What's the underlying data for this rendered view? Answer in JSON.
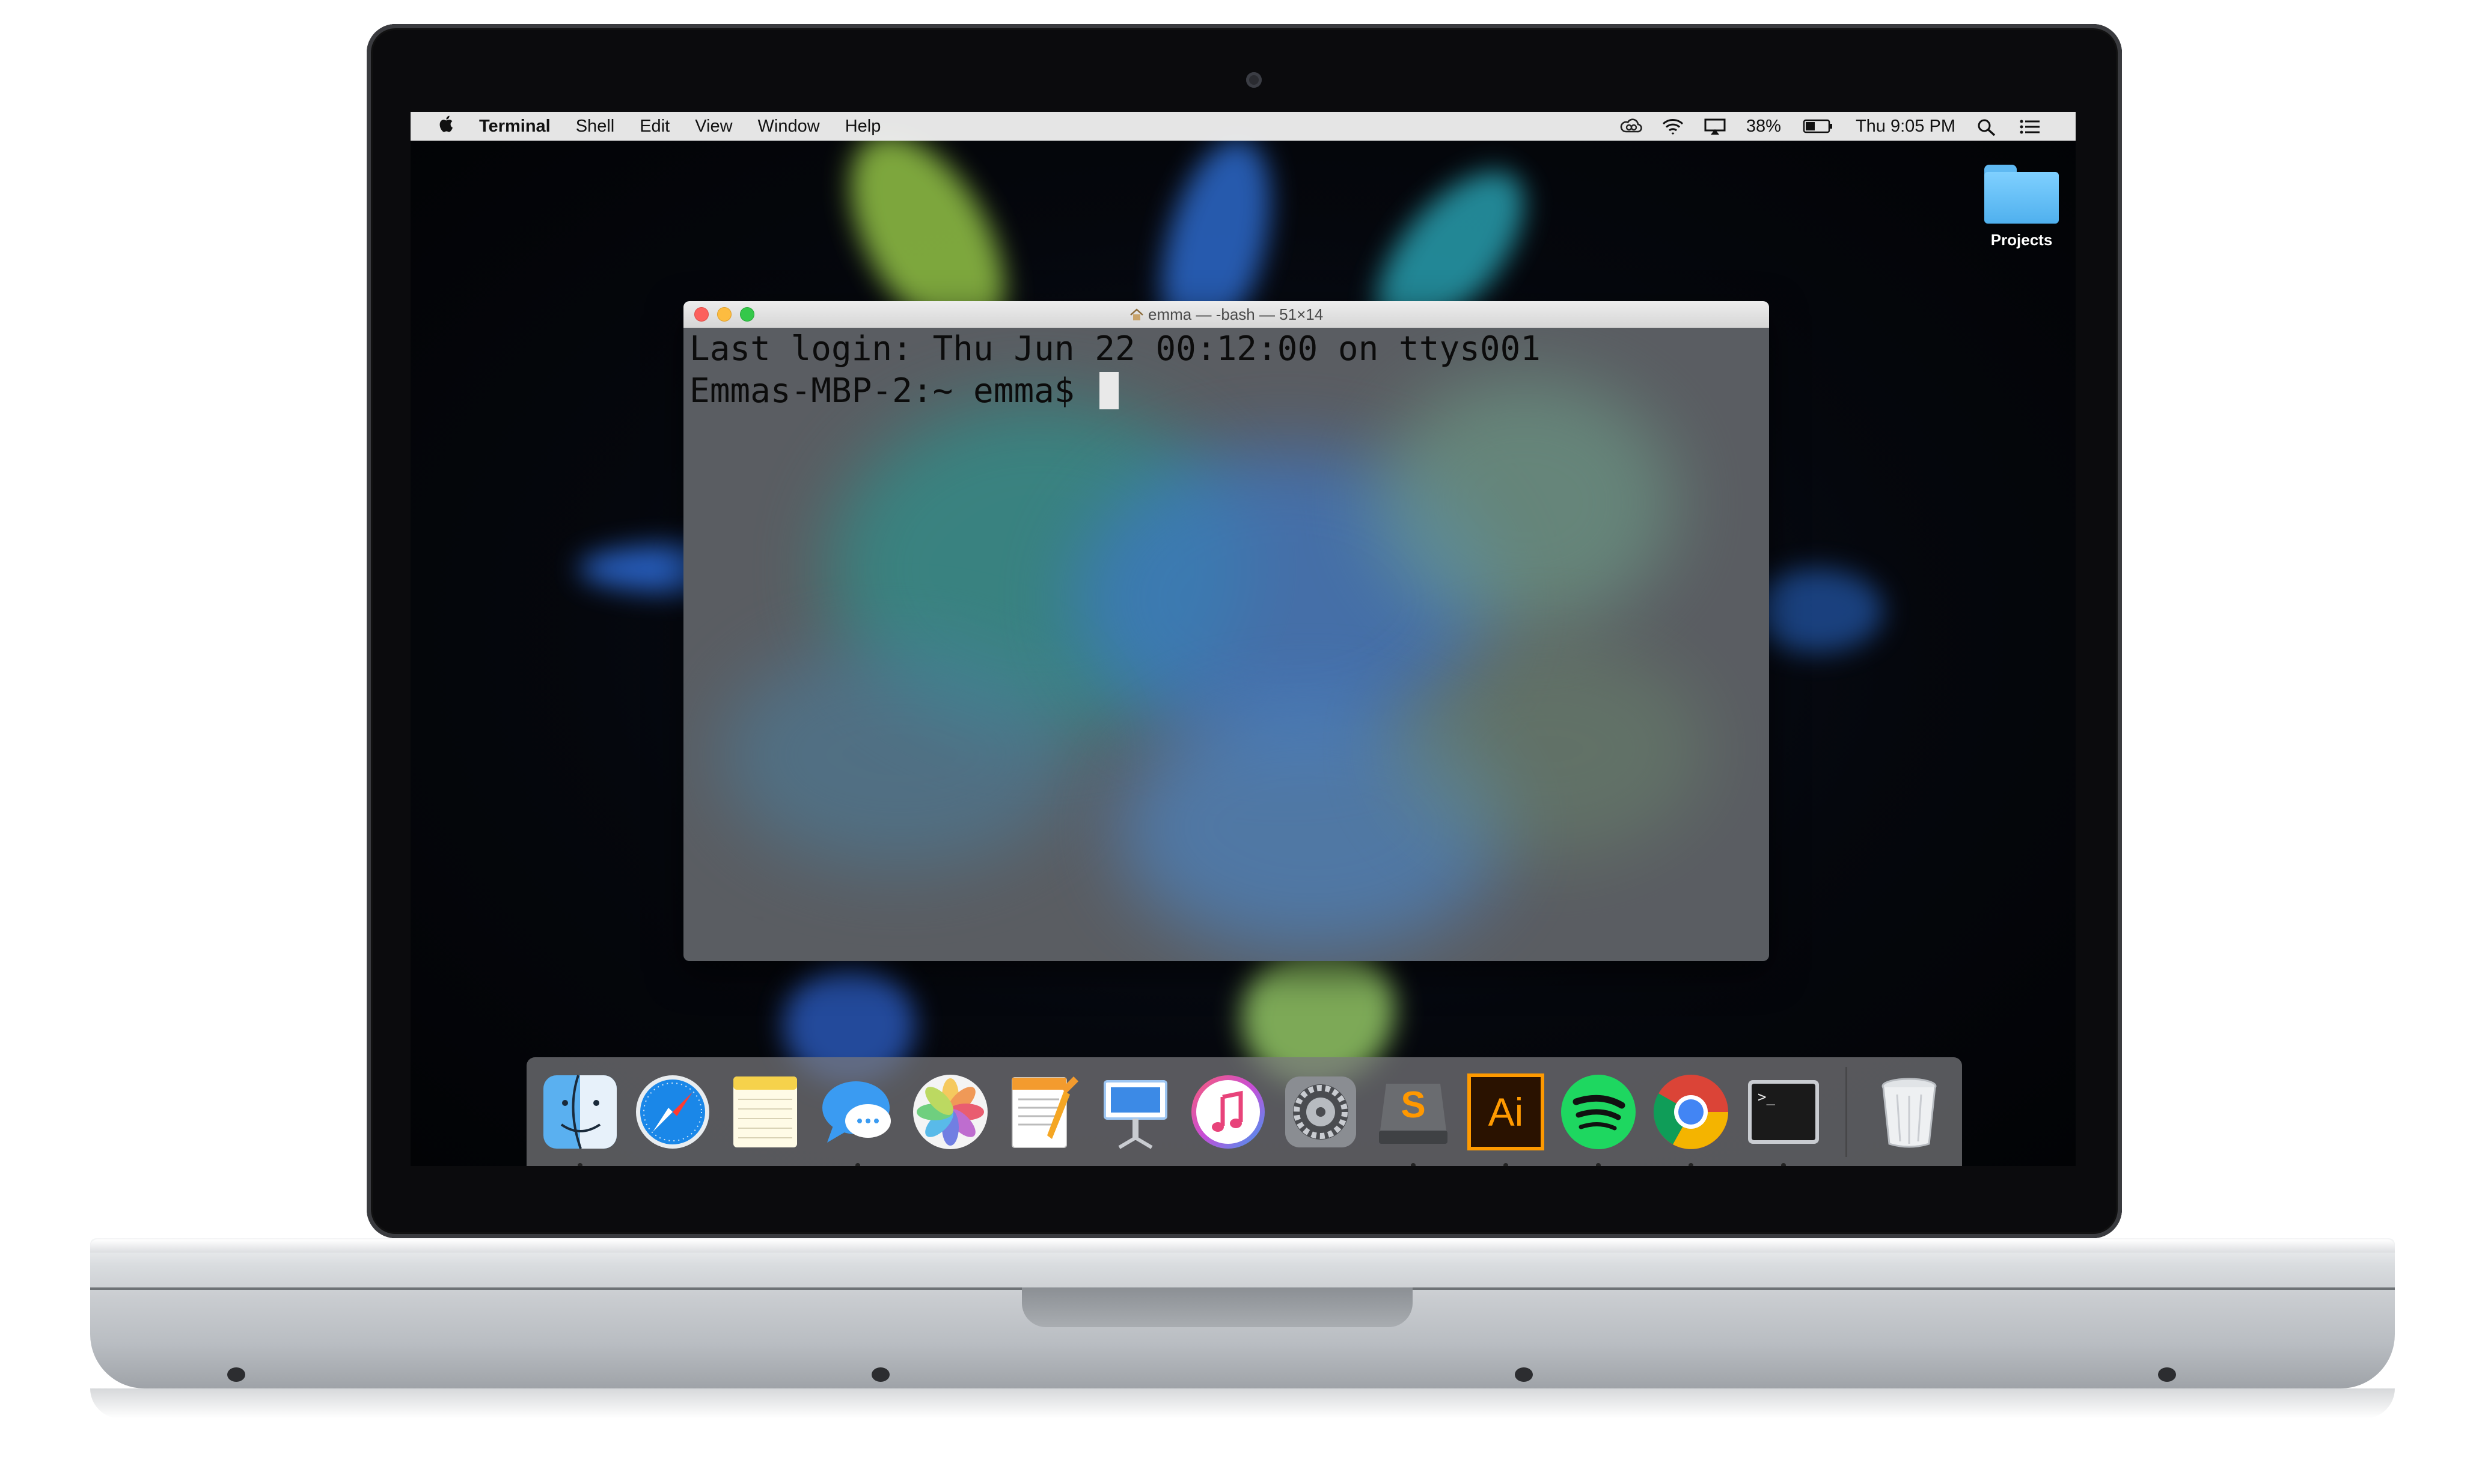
{
  "menubar": {
    "apple": "",
    "app_name": "Terminal",
    "menus": [
      "Shell",
      "Edit",
      "View",
      "Window",
      "Help"
    ],
    "battery_percent": "38%",
    "clock": "Thu 9:05 PM",
    "status_icons": [
      "creative-cloud-icon",
      "wifi-icon",
      "airplay-icon",
      "battery-icon",
      "spotlight-icon",
      "notification-center-icon"
    ]
  },
  "desktop": {
    "folder_label": "Projects"
  },
  "terminal": {
    "title": "emma — -bash — 51×14",
    "title_icon": "home-icon",
    "line1": "Last login: Thu Jun 22 00:12:00 on ttys001",
    "line2": "Emmas-MBP-2:~ emma$ "
  },
  "dock": {
    "apps": [
      {
        "name": "finder-icon",
        "running": true
      },
      {
        "name": "safari-icon",
        "running": false
      },
      {
        "name": "notes-icon",
        "running": false
      },
      {
        "name": "messages-icon",
        "running": true
      },
      {
        "name": "photos-icon",
        "running": false
      },
      {
        "name": "pages-icon",
        "running": false
      },
      {
        "name": "keynote-icon",
        "running": false
      },
      {
        "name": "itunes-icon",
        "running": false
      },
      {
        "name": "system-preferences-icon",
        "running": false
      },
      {
        "name": "sublime-text-icon",
        "running": true
      },
      {
        "name": "illustrator-icon",
        "running": true
      },
      {
        "name": "spotify-icon",
        "running": true
      },
      {
        "name": "chrome-icon",
        "running": true
      },
      {
        "name": "terminal-icon",
        "running": true
      },
      {
        "name": "trash-icon",
        "running": false
      }
    ],
    "illustrator_label": "Ai",
    "sublime_label": "S",
    "terminal_prompt": ">_"
  },
  "colors": {
    "close": "#fc605c",
    "minimize": "#fdbc40",
    "zoom": "#34c84a",
    "folder": "#5fb9f2",
    "spotify": "#1ed760",
    "illustrator_bg": "#2a1200",
    "illustrator_fg": "#ff9a00"
  }
}
